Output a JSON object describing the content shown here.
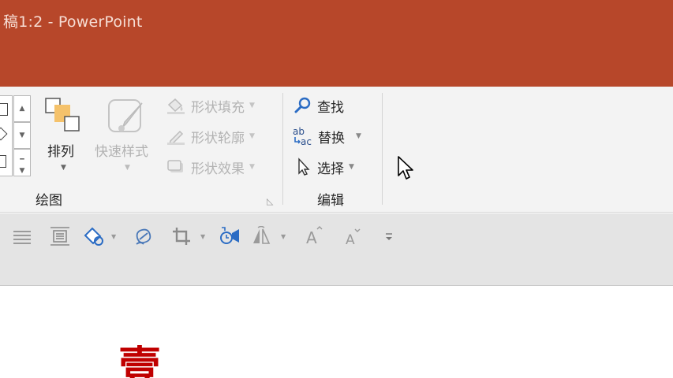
{
  "window": {
    "title": "稿1:2  -  PowerPoint",
    "accent_color": "#b7472a"
  },
  "ribbon": {
    "drawing_group": {
      "label": "绘图",
      "arrange_label": "排列",
      "quick_styles_label": "快速样式",
      "shape_fill_label": "形状填充",
      "shape_outline_label": "形状轮廓",
      "shape_effects_label": "形状效果"
    },
    "editing_group": {
      "label": "编辑",
      "find_label": "查找",
      "replace_label": "替换",
      "select_label": "选择"
    }
  },
  "quick_access_toolbar": {
    "icons": [
      "align-icon",
      "distribute-icon",
      "shape-fill-icon",
      "recolor-icon",
      "crop-icon",
      "animation-icon",
      "text-direction-icon",
      "increase-font-icon",
      "decrease-font-icon",
      "customize-icon"
    ]
  },
  "slide": {
    "visible_text": "壹",
    "text_color": "#c00000"
  }
}
